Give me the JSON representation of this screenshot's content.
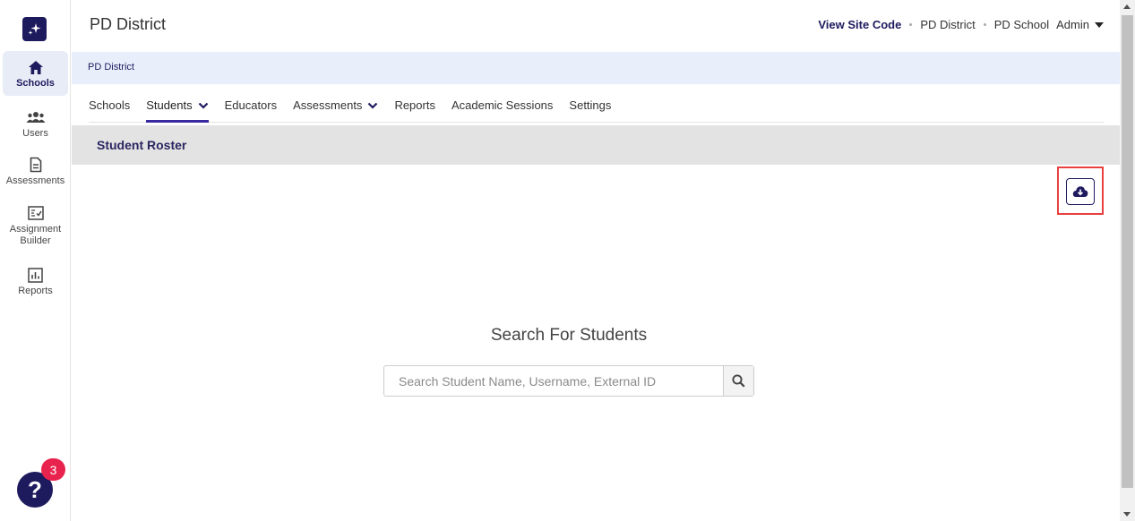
{
  "sidebar": {
    "items": [
      {
        "label": "Schools",
        "icon": "home-icon"
      },
      {
        "label": "Users",
        "icon": "users-icon"
      },
      {
        "label": "Assessments",
        "icon": "document-icon"
      },
      {
        "label": "Assignment Builder",
        "icon": "checklist-icon"
      },
      {
        "label": "Reports",
        "icon": "bar-chart-icon"
      }
    ],
    "help_badge": "3",
    "help_label": "?"
  },
  "header": {
    "title": "PD District",
    "site_code_link": "View Site Code",
    "district": "PD District",
    "school": "PD School",
    "user_role": "Admin"
  },
  "breadcrumb": "PD District",
  "tabs": [
    {
      "label": "Schools"
    },
    {
      "label": "Students"
    },
    {
      "label": "Educators"
    },
    {
      "label": "Assessments"
    },
    {
      "label": "Reports"
    },
    {
      "label": "Academic Sessions"
    },
    {
      "label": "Settings"
    }
  ],
  "section": {
    "title": "Student Roster"
  },
  "search": {
    "heading": "Search For Students",
    "placeholder": "Search Student Name, Username, External ID",
    "value": ""
  },
  "colors": {
    "brand": "#1e1a5e",
    "accent": "#3a2aa0",
    "badge": "#e8234d",
    "highlight": "#e8413f"
  }
}
